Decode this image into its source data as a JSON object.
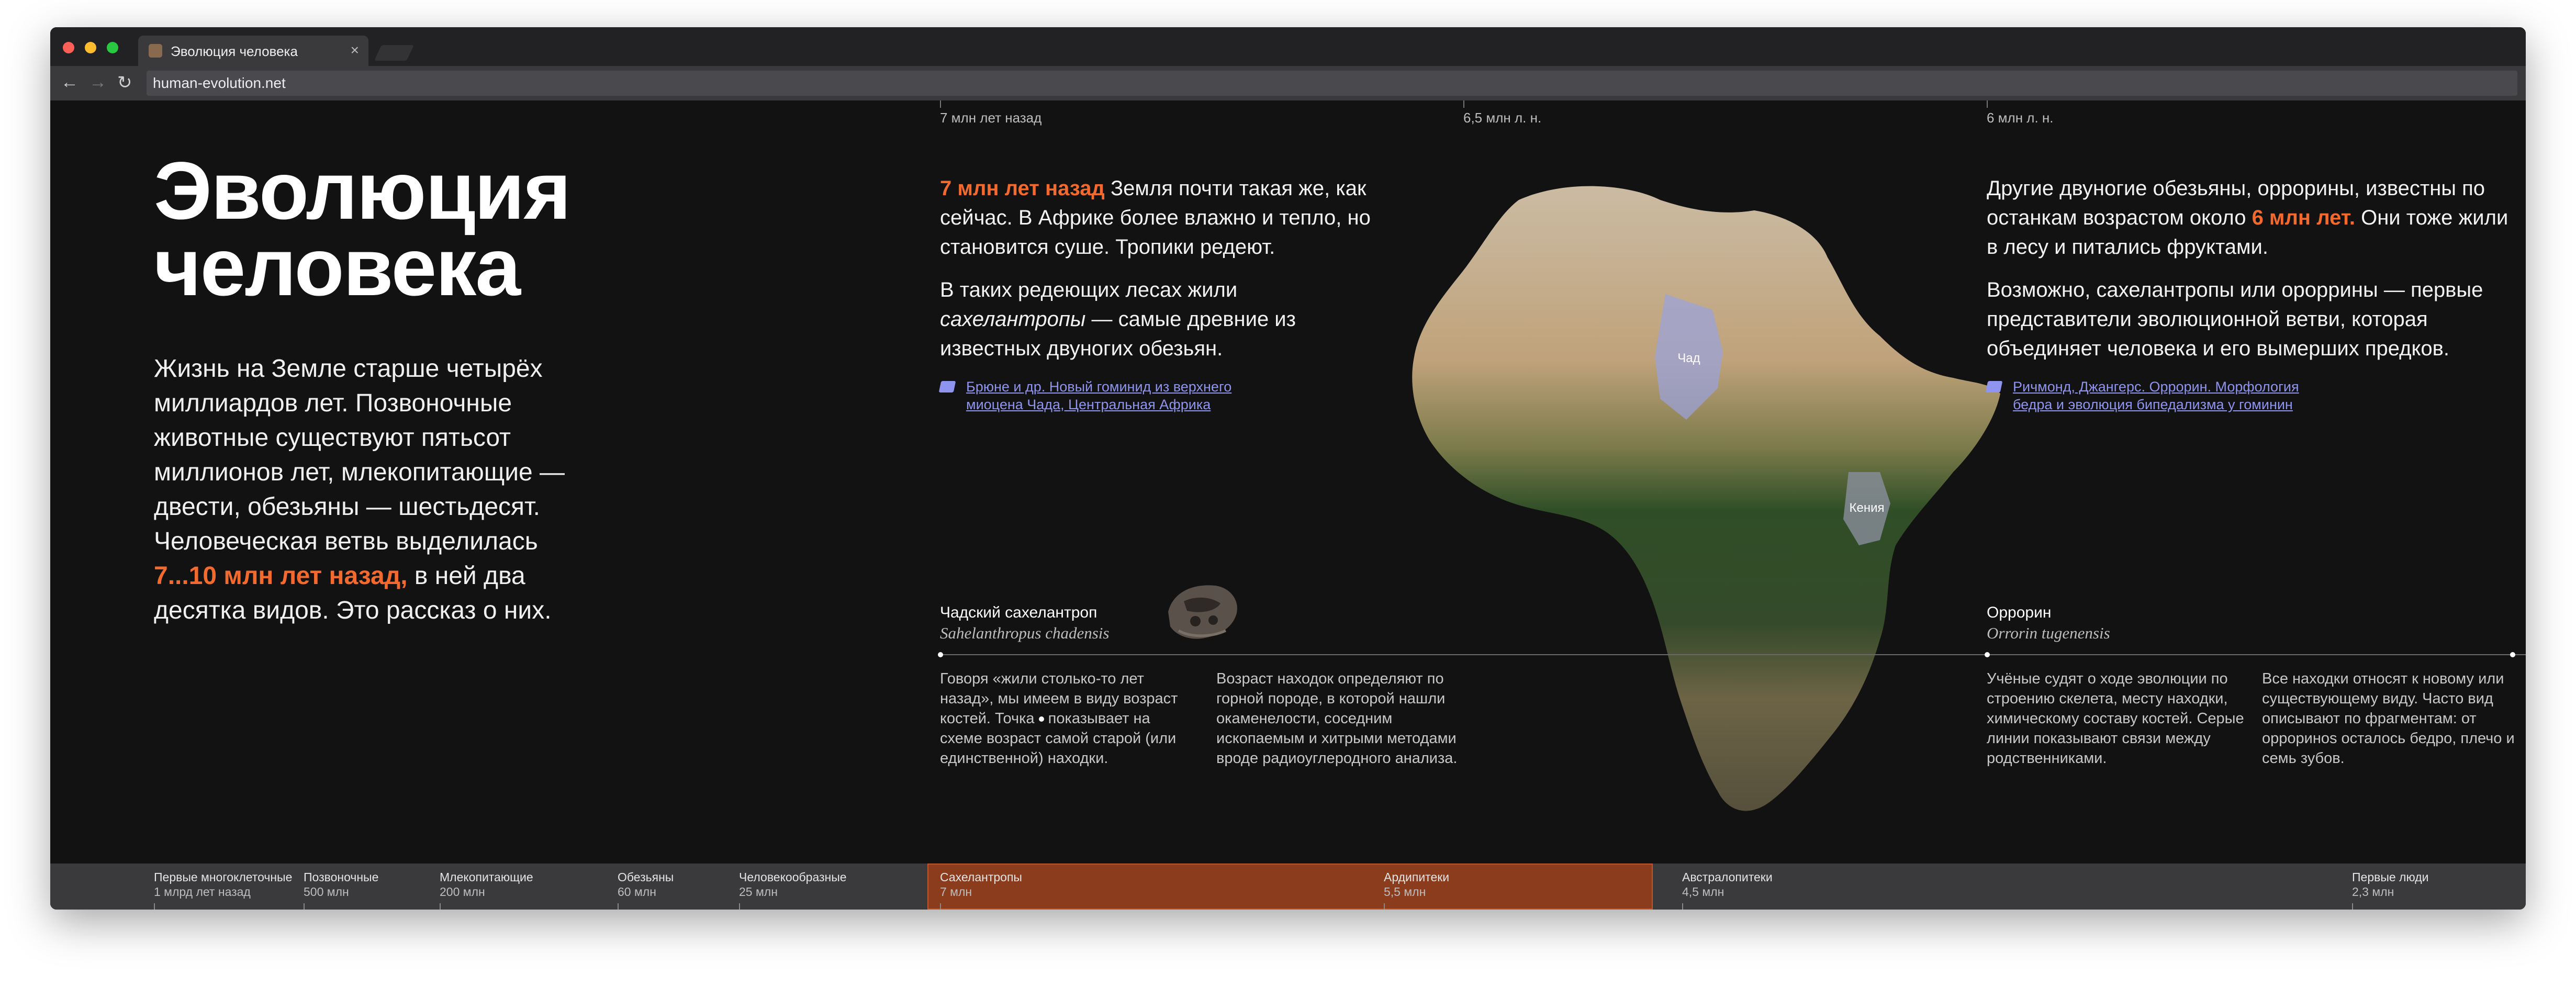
{
  "browser": {
    "tab_title": "Эволюция человека",
    "tab_close": "×",
    "url": "human-evolution.net",
    "nav_icons": [
      "back-arrow-icon",
      "forward-arrow-icon",
      "reload-icon"
    ],
    "traffic_lights": [
      "#fe5f57",
      "#febc2e",
      "#28c840"
    ]
  },
  "page": {
    "title_line1": "Эволюция",
    "title_line2": "человека",
    "intro_before": "Жизнь на Земле старше четырёх миллиардов лет. Позвоночные животные существуют пятьсот миллионов лет, млекопитающие — двести, обезьяны — шестьдесят. Человеческая ветвь выделилась ",
    "intro_highlight": "7...10 млн лет назад,",
    "intro_after": " в ней два десятка видов. Это рассказ о них.",
    "accent_color": "#f26a2e",
    "link_color": "#8f94ee"
  },
  "top_ticks": [
    "7 млн лет назад",
    "6,5 млн л. н.",
    "6 млн л. н."
  ],
  "left_column": {
    "p1_highlight": "7 млн лет назад",
    "p1_rest": " Земля почти такая же, как сейчас. В Африке более влажно и тепло, но становится суше. Тропики редеют.",
    "p2_before": "В таких редеющих лесах жили ",
    "p2_italic": "сахелантропы",
    "p2_after": " — самые древние из известных двуногих обезьян.",
    "citation": "Брюне и др. Новый гоминид из верхнего миоцена Чада, Центральная Африка",
    "citation_icon": "book-icon"
  },
  "right_column": {
    "p1_before": "Другие двуногие обезьяны, оррорины, известны по останкам возрастом около ",
    "p1_highlight": "6 млн лет.",
    "p1_after": " Они тоже жили в лесу и питались фруктами.",
    "p2": "Возможно, сахелантропы или ороррины — первые представители эволюционной ветви, которая объединяет человека и его вымерших предков.",
    "citation": "Ричмонд, Джангерс. Оррорин. Морфология бедра и эволюция бипедализма у гоминин",
    "citation_icon": "book-icon"
  },
  "map": {
    "label_chad": "Чад",
    "label_kenya": "Кения"
  },
  "species": [
    {
      "name": "Чадский сахелантроп",
      "latin": "Sahelanthropus chadensis"
    },
    {
      "name": "Оррорин",
      "latin": "Orrorin tugenensis"
    }
  ],
  "notes": {
    "n1_before": "Говоря «жили столько-то лет назад», мы имеем в виду возраст костей. Точка",
    "n1_after": "показывает на схеме возраст самой старой (или единственной) находки.",
    "n2": "Возраст находок определяют по горной породе, в которой нашли окаменелости, соседним ископаемым и хитрыми методами вроде радиоуглеродного анализа.",
    "n3": "Учёные судят о ходе эволюции по строению скелета, месту находки, химическому составу костей. Серые линии показывают связи между родственниками.",
    "n4": "Все находки относят к новому или существующему виду. Часто вид описывают по фрагментам: от оррориноs осталось бедро, плечо и семь зубов."
  },
  "eras": [
    {
      "name": "Первые многоклеточные",
      "time": "1 млрд лет назад"
    },
    {
      "name": "Позвоночные",
      "time": "500 млн"
    },
    {
      "name": "Млекопитающие",
      "time": "200 млн"
    },
    {
      "name": "Обезьяны",
      "time": "60 млн"
    },
    {
      "name": "Человекообразные",
      "time": "25 млн"
    },
    {
      "name": "Сахелантропы",
      "time": "7 млн"
    },
    {
      "name": "Ардипитеки",
      "time": "5,5 млн"
    },
    {
      "name": "Австралопитеки",
      "time": "4,5 млн"
    },
    {
      "name": "Первые люди",
      "time": "2,3 млн"
    }
  ]
}
